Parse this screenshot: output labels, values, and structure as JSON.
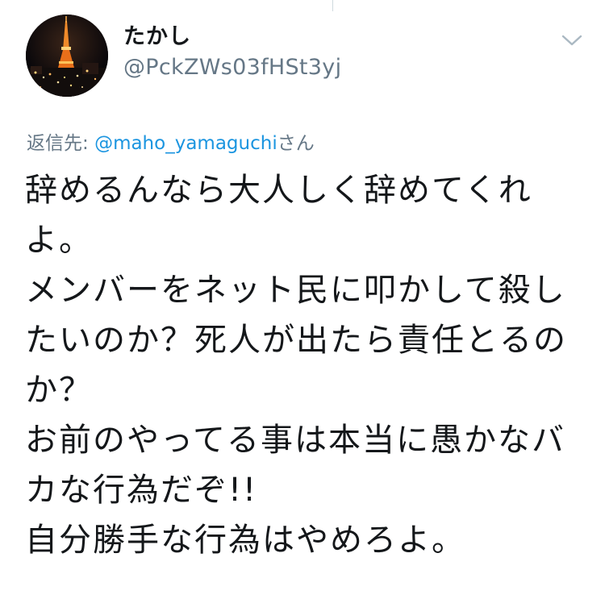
{
  "author": {
    "display_name": "たかし",
    "handle": "@PckZWs03fHSt3yj",
    "avatar_icon": "night-tower-avatar-icon"
  },
  "menu": {
    "icon": "chevron-down-icon"
  },
  "reply": {
    "prefix": "返信先:",
    "mention": "@maho_yamaguchi",
    "suffix": "さん"
  },
  "tweet": {
    "text": "辞めるんなら大人しく辞めてくれよ。\nメンバーをネット民に叩かして殺したいのか？死人が出たら責任とるのか？\nお前のやってる事は本当に愚かなバカな行為だぞ!!\n自分勝手な行為はやめろよ。"
  },
  "colors": {
    "text": "#14171a",
    "secondary": "#657786",
    "link": "#1b95e0"
  }
}
